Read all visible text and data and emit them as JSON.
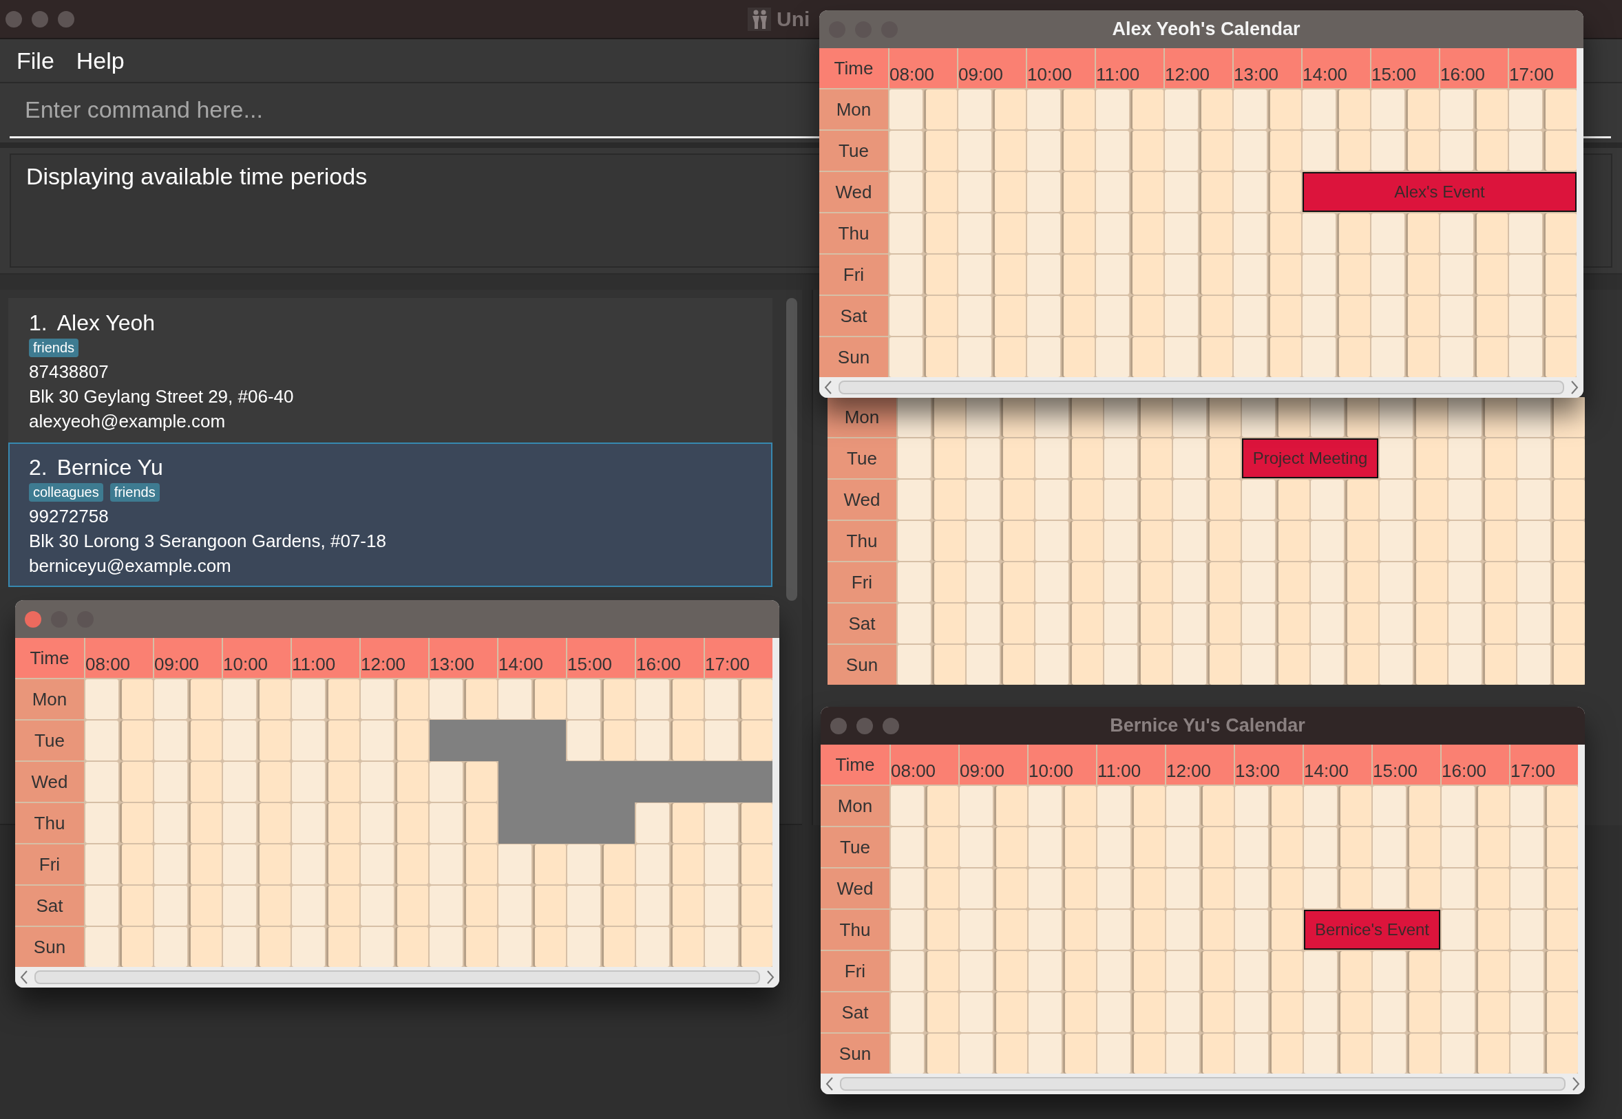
{
  "app": {
    "title": "Uni",
    "menu": [
      "File",
      "Help"
    ],
    "command": {
      "placeholder": "Enter command here..."
    },
    "result": "Displaying available time periods"
  },
  "persons": [
    {
      "index": "1.",
      "name": "Alex Yeoh",
      "tags": [
        "friends"
      ],
      "phone": "87438807",
      "address": "Blk 30 Geylang Street 29, #06-40",
      "email": "alexyeoh@example.com",
      "selected": false
    },
    {
      "index": "2.",
      "name": "Bernice Yu",
      "tags": [
        "colleagues",
        "friends"
      ],
      "phone": "99272758",
      "address": "Blk 30 Lorong 3 Serangoon Gardens, #07-18",
      "email": "berniceyu@example.com",
      "selected": true
    }
  ],
  "calendars": [
    {
      "title_bar": {
        "focused": true,
        "dimmed": false
      },
      "header": {
        "time_label": "Time",
        "hours": [
          "08:00",
          "09:00",
          "10:00",
          "11:00",
          "12:00",
          "13:00",
          "14:00",
          "15:00",
          "16:00",
          "17:00"
        ]
      },
      "scrollbar": true,
      "days": [
        {
          "label": "Mon"
        },
        {
          "label": "Tue",
          "busy": [
            false,
            false,
            false,
            false,
            false,
            false,
            false,
            false,
            false,
            false,
            true,
            true,
            true,
            true,
            false,
            false,
            false,
            false,
            false,
            false
          ]
        },
        {
          "label": "Wed",
          "busy": [
            false,
            false,
            false,
            false,
            false,
            false,
            false,
            false,
            false,
            false,
            false,
            false,
            true,
            true,
            true,
            true,
            true,
            true,
            true,
            true
          ]
        },
        {
          "label": "Thu",
          "busy": [
            false,
            false,
            false,
            false,
            false,
            false,
            false,
            false,
            false,
            false,
            false,
            false,
            true,
            true,
            true,
            true,
            false,
            false,
            false,
            false
          ]
        },
        {
          "label": "Fri"
        },
        {
          "label": "Sat"
        },
        {
          "label": "Sun"
        }
      ]
    },
    {
      "title_bar": {
        "title": "Alex Yeoh's Calendar",
        "focused": false,
        "dimmed": false
      },
      "header": {
        "time_label": "Time",
        "hours": [
          "08:00",
          "09:00",
          "10:00",
          "11:00",
          "12:00",
          "13:00",
          "14:00",
          "15:00",
          "16:00",
          "17:00"
        ]
      },
      "scrollbar": true,
      "days": [
        {
          "label": "Mon"
        },
        {
          "label": "Tue"
        },
        {
          "label": "Wed",
          "event": {
            "label": "Alex's Event",
            "span": [
              false,
              false,
              false,
              false,
              false,
              false,
              false,
              false,
              false,
              false,
              false,
              false,
              true,
              true,
              true,
              true,
              true,
              true,
              true,
              true
            ]
          }
        },
        {
          "label": "Thu"
        },
        {
          "label": "Fri"
        },
        {
          "label": "Sat"
        },
        {
          "label": "Sun"
        }
      ]
    },
    {
      "scrollbar": false,
      "days": [
        {
          "label": "Mon"
        },
        {
          "label": "Tue",
          "event": {
            "label": "Project Meeting",
            "span": [
              false,
              false,
              false,
              false,
              false,
              false,
              false,
              false,
              false,
              false,
              true,
              true,
              true,
              true,
              false,
              false,
              false,
              false,
              false,
              false
            ]
          }
        },
        {
          "label": "Wed"
        },
        {
          "label": "Thu"
        },
        {
          "label": "Fri"
        },
        {
          "label": "Sat"
        },
        {
          "label": "Sun"
        }
      ]
    },
    {
      "title_bar": {
        "title": "Bernice Yu's Calendar",
        "focused": false,
        "dimmed": true
      },
      "header": {
        "time_label": "Time",
        "hours": [
          "08:00",
          "09:00",
          "10:00",
          "11:00",
          "12:00",
          "13:00",
          "14:00",
          "15:00",
          "16:00",
          "17:00"
        ]
      },
      "scrollbar": true,
      "days": [
        {
          "label": "Mon"
        },
        {
          "label": "Tue"
        },
        {
          "label": "Wed"
        },
        {
          "label": "Thu",
          "event": {
            "label": "Bernice's Event",
            "span": [
              false,
              false,
              false,
              false,
              false,
              false,
              false,
              false,
              false,
              false,
              false,
              false,
              true,
              true,
              true,
              true,
              false,
              false,
              false,
              false
            ]
          }
        },
        {
          "label": "Fri"
        },
        {
          "label": "Sat"
        },
        {
          "label": "Sun"
        }
      ]
    }
  ]
}
